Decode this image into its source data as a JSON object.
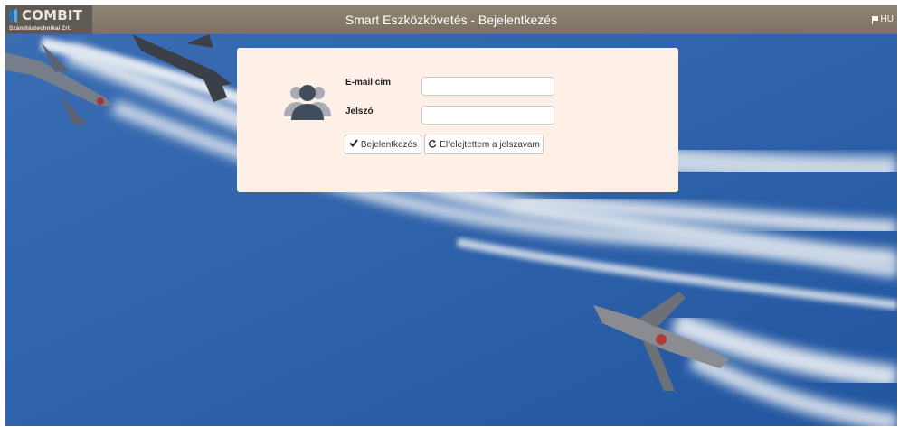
{
  "header": {
    "logo_text": "COMBIT",
    "logo_subtitle": "Számítástechnikai Zrt.",
    "title": "Smart Eszközkövetés - Bejelentkezés",
    "language": "HU"
  },
  "login": {
    "email_label": "E-mail cím",
    "email_value": "",
    "password_label": "Jelszó",
    "password_value": "",
    "login_button": "Bejelentkezés",
    "forgot_button": "Elfelejtettem a jelszavam"
  },
  "icons": {
    "avatar": "users-icon",
    "login": "check-icon",
    "forgot": "refresh-icon",
    "language": "flag-icon"
  },
  "colors": {
    "header_bg": "#85796a",
    "card_bg": "#fef0e6",
    "sky": "#2a5fa6"
  }
}
